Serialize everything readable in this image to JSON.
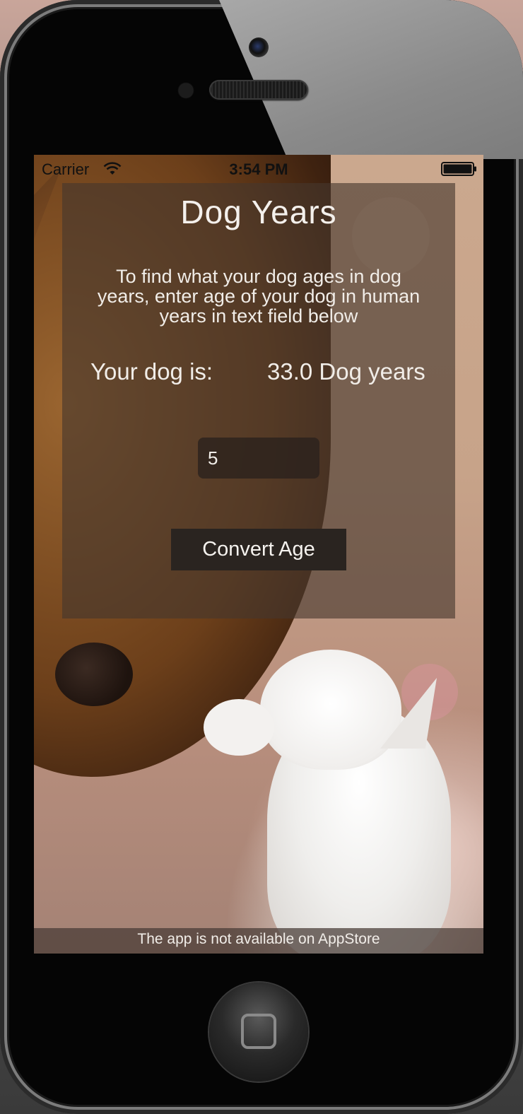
{
  "status_bar": {
    "carrier": "Carrier",
    "time": "3:54 PM",
    "wifi_icon": "wifi-icon",
    "battery_icon": "battery-icon"
  },
  "app": {
    "title": "Dog Years",
    "instructions": "To find what your dog ages in dog years, enter age of your dog in human years in text field below",
    "result_label": "Your dog is:",
    "result_value": "33.0 Dog years",
    "age_input": {
      "value": "5",
      "placeholder": ""
    },
    "convert_button_label": "Convert Age",
    "footer": "The app is not available on AppStore"
  },
  "colors": {
    "panel_bg": "#463729",
    "button_bg": "#2a2420",
    "text": "#f1ede8"
  },
  "device": {
    "home_button_icon": "home-square-icon"
  }
}
